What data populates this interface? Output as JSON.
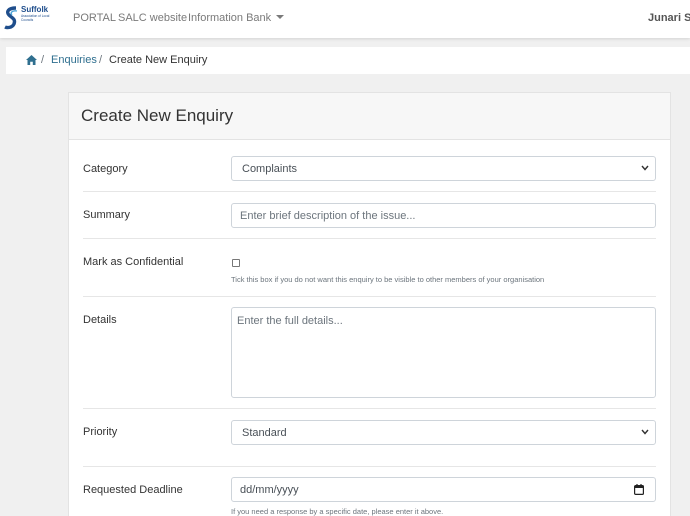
{
  "nav": {
    "logo": {
      "name": "Suffolk",
      "subtitle": "Association of Local Councils",
      "color": "#1f4e8c"
    },
    "links": [
      "PORTAL",
      "SALC website",
      "Information Bank"
    ],
    "user": "Junari Su"
  },
  "breadcrumb": {
    "home_icon": "home-icon",
    "items": [
      "Enquiries",
      "Create New Enquiry"
    ],
    "separator": "/"
  },
  "form": {
    "title": "Create New Enquiry",
    "category": {
      "label": "Category",
      "value": "Complaints"
    },
    "summary": {
      "label": "Summary",
      "placeholder": "Enter brief description of the issue..."
    },
    "confidential": {
      "label": "Mark as Confidential",
      "checked": false,
      "help": "Tick this box if you do not want this enquiry to be visible to other members of your organisation"
    },
    "details": {
      "label": "Details",
      "placeholder": "Enter the full details..."
    },
    "priority": {
      "label": "Priority",
      "value": "Standard"
    },
    "deadline": {
      "label": "Requested Deadline",
      "value": "dd/mm/yyyy",
      "icon": "calendar-icon",
      "help": "If you need a response by a specific date, please enter it above."
    }
  },
  "colors": {
    "link": "#2f6f8f",
    "page_bg": "#f0f0f0",
    "card_header_bg": "#f7f7f7"
  }
}
